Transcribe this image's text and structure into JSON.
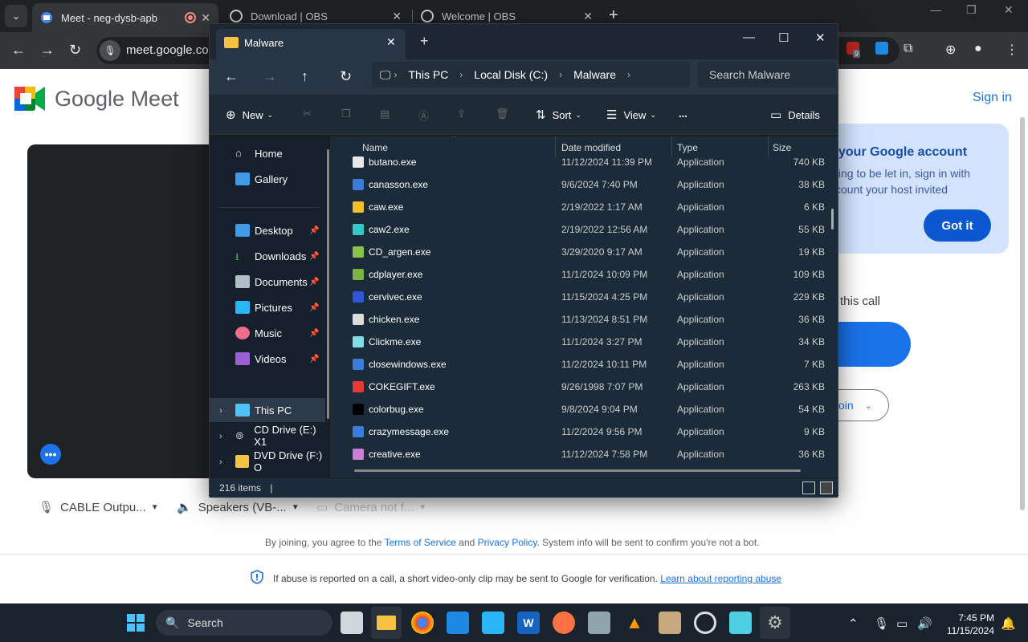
{
  "chrome": {
    "tabs": [
      {
        "title": "Meet - neg-dysb-apb",
        "active": true
      },
      {
        "title": "Download | OBS",
        "active": false
      },
      {
        "title": "Welcome | OBS",
        "active": false
      }
    ],
    "url": "meet.google.com",
    "extension_badge": "9"
  },
  "meet": {
    "logo_text": "Google Meet",
    "sign_in": "Sign in",
    "tip": {
      "title": "your Google account",
      "body": "ting to be let in, sign in with count your host invited",
      "button": "Got it"
    },
    "join_heading": "this call",
    "other_join": "oin",
    "devices": {
      "mic": "CABLE Outpu...",
      "speakers": "Speakers (VB-...",
      "camera": "Camera not f..."
    },
    "terms": {
      "prefix": "By joining, you agree to the",
      "tos": "Terms of Service",
      "and": "and",
      "privacy": "Privacy Policy",
      "suffix": ". System info will be sent to confirm you're not a bot."
    },
    "abuse": {
      "text": "If abuse is reported on a call, a short video-only clip may be sent to Google for verification.",
      "link": "Learn about reporting abuse"
    }
  },
  "explorer": {
    "tab_title": "Malware",
    "breadcrumb": [
      "This PC",
      "Local Disk (C:)",
      "Malware"
    ],
    "search_placeholder": "Search Malware",
    "commands": {
      "new": "New",
      "sort": "Sort",
      "view": "View",
      "more": "...",
      "details": "Details"
    },
    "sidebar": {
      "home": "Home",
      "gallery": "Gallery",
      "pinned": [
        "Desktop",
        "Downloads",
        "Documents",
        "Pictures",
        "Music",
        "Videos"
      ],
      "this_pc": "This PC",
      "cd_drive": "CD Drive (E:) X1",
      "dvd_drive": "DVD Drive (F:) O"
    },
    "columns": [
      "Name",
      "Date modified",
      "Type",
      "Size"
    ],
    "files": [
      {
        "name": "butano.exe",
        "date": "11/12/2024 11:39 PM",
        "type": "Application",
        "size": "740 KB",
        "color": "#e8e8e8"
      },
      {
        "name": "canasson.exe",
        "date": "9/6/2024 7:40 PM",
        "type": "Application",
        "size": "38 KB",
        "color": "#3d7bd9"
      },
      {
        "name": "caw.exe",
        "date": "2/19/2022 1:17 AM",
        "type": "Application",
        "size": "6 KB",
        "color": "#f2c029"
      },
      {
        "name": "caw2.exe",
        "date": "2/19/2022 12:56 AM",
        "type": "Application",
        "size": "55 KB",
        "color": "#35c6c6"
      },
      {
        "name": "CD_argen.exe",
        "date": "3/29/2020 9:17 AM",
        "type": "Application",
        "size": "19 KB",
        "color": "#8bc34a"
      },
      {
        "name": "cdplayer.exe",
        "date": "11/1/2024 10:09 PM",
        "type": "Application",
        "size": "109 KB",
        "color": "#7cb342"
      },
      {
        "name": "cervivec.exe",
        "date": "11/15/2024 4:25 PM",
        "type": "Application",
        "size": "229 KB",
        "color": "#2f56d4"
      },
      {
        "name": "chicken.exe",
        "date": "11/13/2024 8:51 PM",
        "type": "Application",
        "size": "36 KB",
        "color": "#dcdcdc"
      },
      {
        "name": "Clickme.exe",
        "date": "11/1/2024 3:27 PM",
        "type": "Application",
        "size": "34 KB",
        "color": "#80deea"
      },
      {
        "name": "closewindows.exe",
        "date": "11/2/2024 10:11 PM",
        "type": "Application",
        "size": "7 KB",
        "color": "#3d7bd9"
      },
      {
        "name": "COKEGIFT.exe",
        "date": "9/26/1998 7:07 PM",
        "type": "Application",
        "size": "263 KB",
        "color": "#e53935"
      },
      {
        "name": "colorbug.exe",
        "date": "9/8/2024 9:04 PM",
        "type": "Application",
        "size": "54 KB",
        "color": "#000000"
      },
      {
        "name": "crazymessage.exe",
        "date": "11/2/2024 9:56 PM",
        "type": "Application",
        "size": "9 KB",
        "color": "#3d7bd9"
      },
      {
        "name": "creative.exe",
        "date": "11/12/2024 7:58 PM",
        "type": "Application",
        "size": "36 KB",
        "color": "#c97fd6"
      }
    ],
    "status": "216 items"
  },
  "taskbar": {
    "search": "Search",
    "time": "7:45 PM",
    "date": "11/15/2024"
  }
}
